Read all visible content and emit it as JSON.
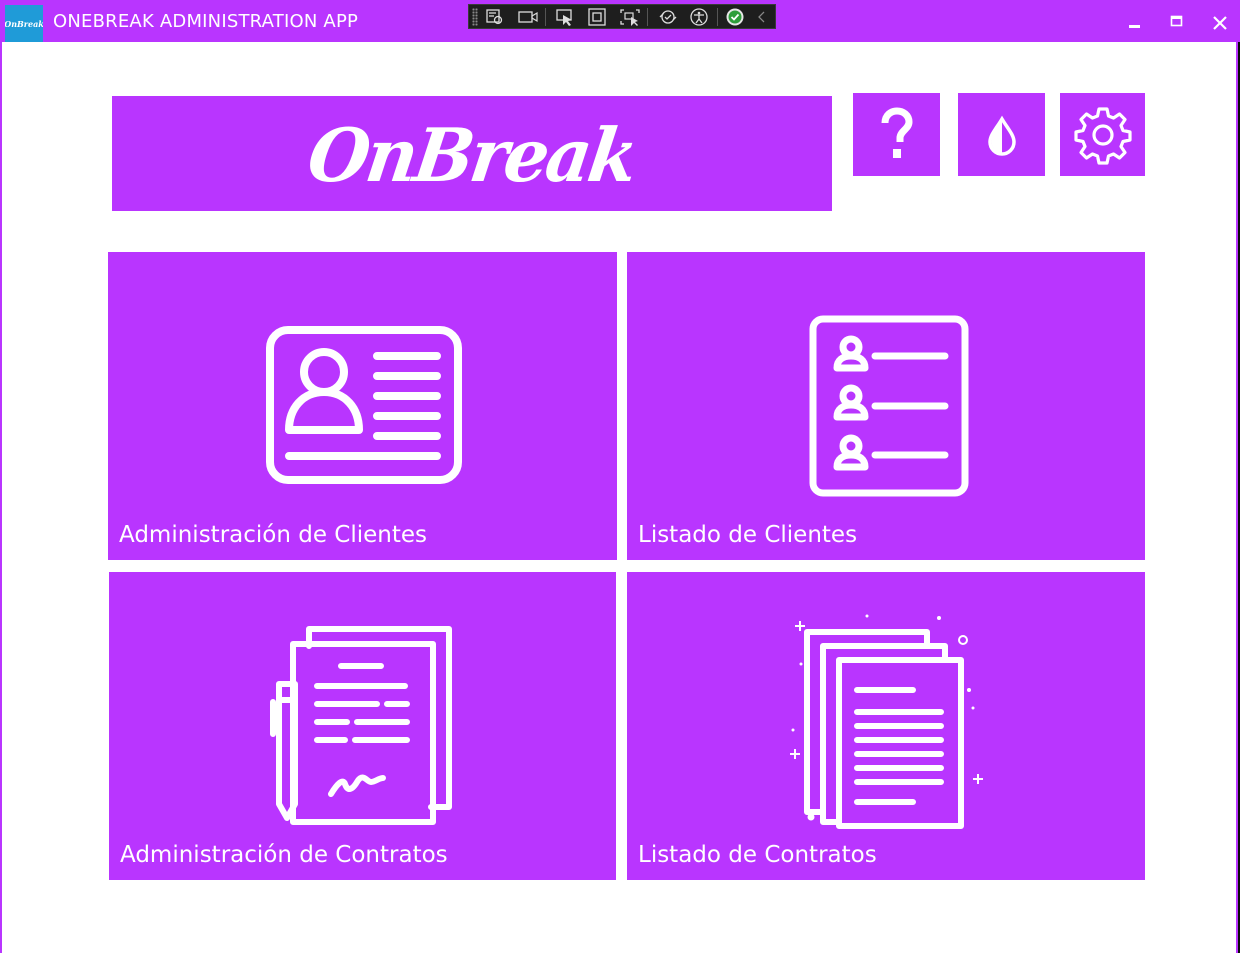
{
  "window": {
    "title": "ONEBREAK ADMINISTRATION APP",
    "app_icon_text": "OnBreak",
    "controls": [
      "minimize-icon",
      "maximize-icon",
      "close-icon"
    ]
  },
  "debug_toolbar": {
    "icons": [
      "select-element-icon",
      "video-icon",
      "pointer-icon",
      "bounding-box-icon",
      "track-focus-icon",
      "hot-reload-icon",
      "accessibility-icon",
      "check-circle-icon",
      "chevron-left-icon"
    ]
  },
  "header": {
    "logo_text": "OnBreak",
    "buttons": [
      {
        "name": "help-button",
        "icon": "question-icon"
      },
      {
        "name": "theme-button",
        "icon": "droplet-icon"
      },
      {
        "name": "settings-button",
        "icon": "gear-icon"
      }
    ]
  },
  "tiles": [
    {
      "label": "Administración de Clientes",
      "icon": "id-card-icon"
    },
    {
      "label": "Listado de Clientes",
      "icon": "client-list-icon"
    },
    {
      "label": "Administración de Contratos",
      "icon": "contract-sign-icon"
    },
    {
      "label": "Listado de Contratos",
      "icon": "documents-stack-icon"
    }
  ],
  "colors": {
    "accent": "#b935ff",
    "app_icon_bg": "#1f9bd8",
    "background": "#ffffff"
  }
}
